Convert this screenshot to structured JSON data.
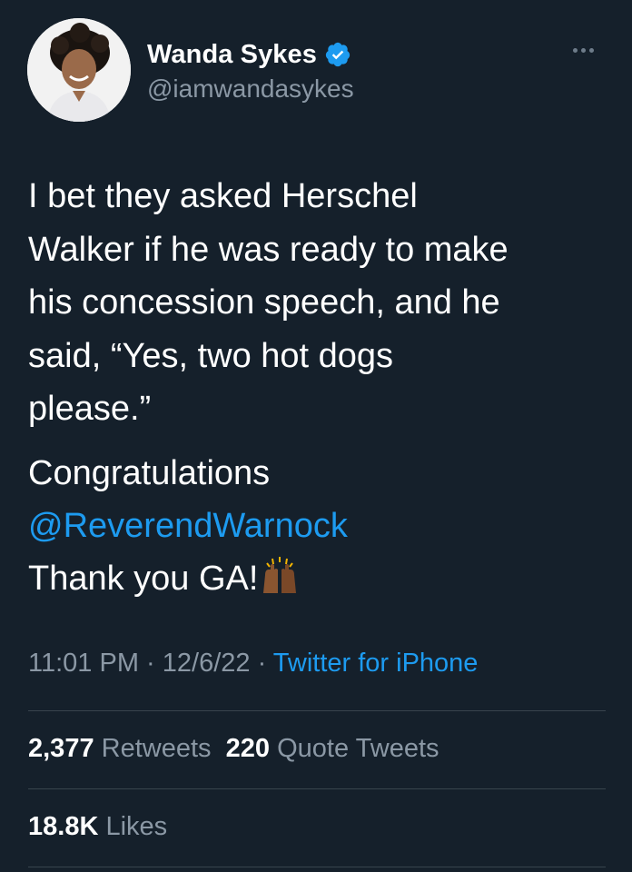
{
  "author": {
    "display_name": "Wanda Sykes",
    "handle": "@iamwandasykes",
    "verified": true,
    "avatar_icon": "profile-photo"
  },
  "more_icon": "more-horizontal-icon",
  "tweet": {
    "text": "I bet they asked Herschel\nWalker if he was ready to make\nhis concession speech, and he\nsaid, “Yes, two hot dogs\nplease.”",
    "line_congrats": "Congratulations",
    "mention": "@ReverendWarnock",
    "line_thanks": "Thank you GA!",
    "emoji": "raising-hands-emoji"
  },
  "meta": {
    "time": "11:01 PM",
    "sep1": " · ",
    "date": "12/6/22",
    "sep2": " · ",
    "source": "Twitter for iPhone"
  },
  "stats": {
    "retweets_count": "2,377",
    "retweets_label": "Retweets",
    "quotes_count": "220",
    "quotes_label": "Quote Tweets",
    "likes_count": "18.8K",
    "likes_label": "Likes"
  },
  "colors": {
    "background": "#15202b",
    "accent": "#1d9bf0",
    "secondary_text": "#8b98a5",
    "divider": "#38444d"
  }
}
